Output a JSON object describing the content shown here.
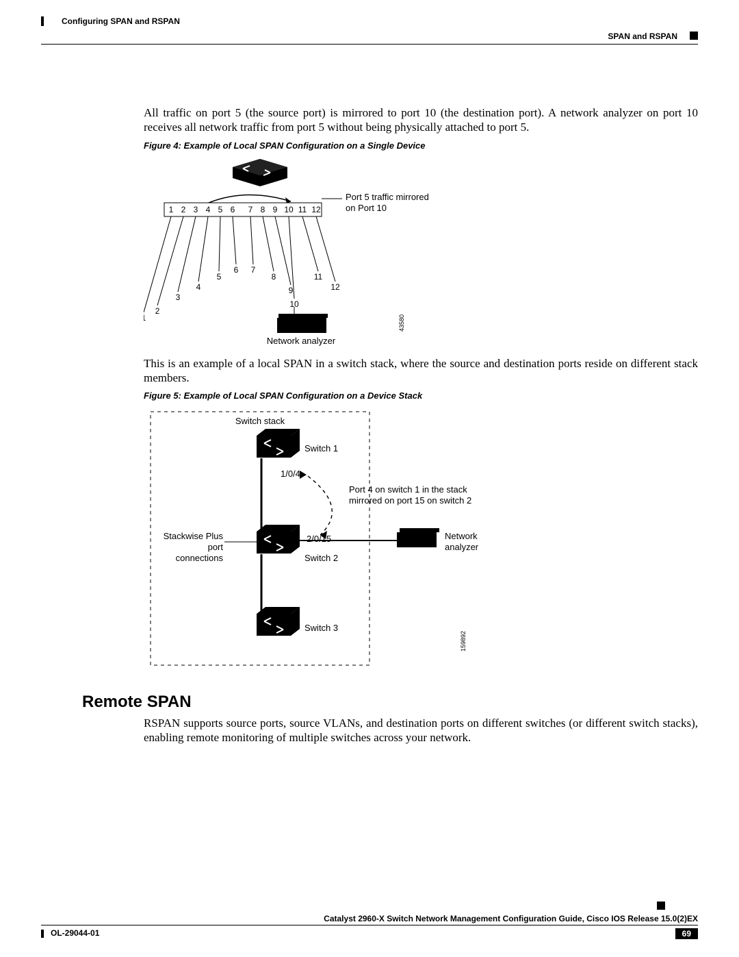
{
  "header": {
    "breadcrumb": "Configuring SPAN and RSPAN",
    "section": "SPAN and RSPAN"
  },
  "para1": "All traffic on port 5 (the source port) is mirrored to port 10 (the destination port). A network analyzer on port 10 receives all network traffic from port 5 without being physically attached to port 5.",
  "fig4_caption": "Figure 4: Example of Local SPAN Configuration on a Single Device",
  "fig4": {
    "ports": [
      "1",
      "2",
      "3",
      "4",
      "5",
      "6",
      "7",
      "8",
      "9",
      "10",
      "11",
      "12"
    ],
    "annot1": "Port 5 traffic mirrored",
    "annot2": "on Port 10",
    "analyzer_label": "Network analyzer",
    "image_id": "43580"
  },
  "para2": "This is an example of a local SPAN in a switch stack, where the source and destination ports reside on different stack members.",
  "fig5_caption": "Figure 5: Example of Local SPAN Configuration on a Device Stack",
  "fig5": {
    "stack_label": "Switch stack",
    "sw1": "Switch 1",
    "sw2": "Switch 2",
    "sw3": "Switch 3",
    "p1": "1/0/4",
    "p2": "2/0/15",
    "annot1": "Port 4 on switch 1 in the stack",
    "annot2": "mirrored on port 15 on switch 2",
    "left1": "Stackwise Plus",
    "left2": "port",
    "left3": "connections",
    "na1": "Network",
    "na2": "analyzer",
    "image_id": "159892"
  },
  "heading_remote": "Remote SPAN",
  "para3": "RSPAN supports source ports, source VLANs, and destination ports on different switches (or different switch stacks), enabling remote monitoring of multiple switches across your network.",
  "footer": {
    "guide": "Catalyst 2960-X Switch Network Management Configuration Guide, Cisco IOS Release 15.0(2)EX",
    "docnum": "OL-29044-01",
    "pagenum": "69"
  }
}
